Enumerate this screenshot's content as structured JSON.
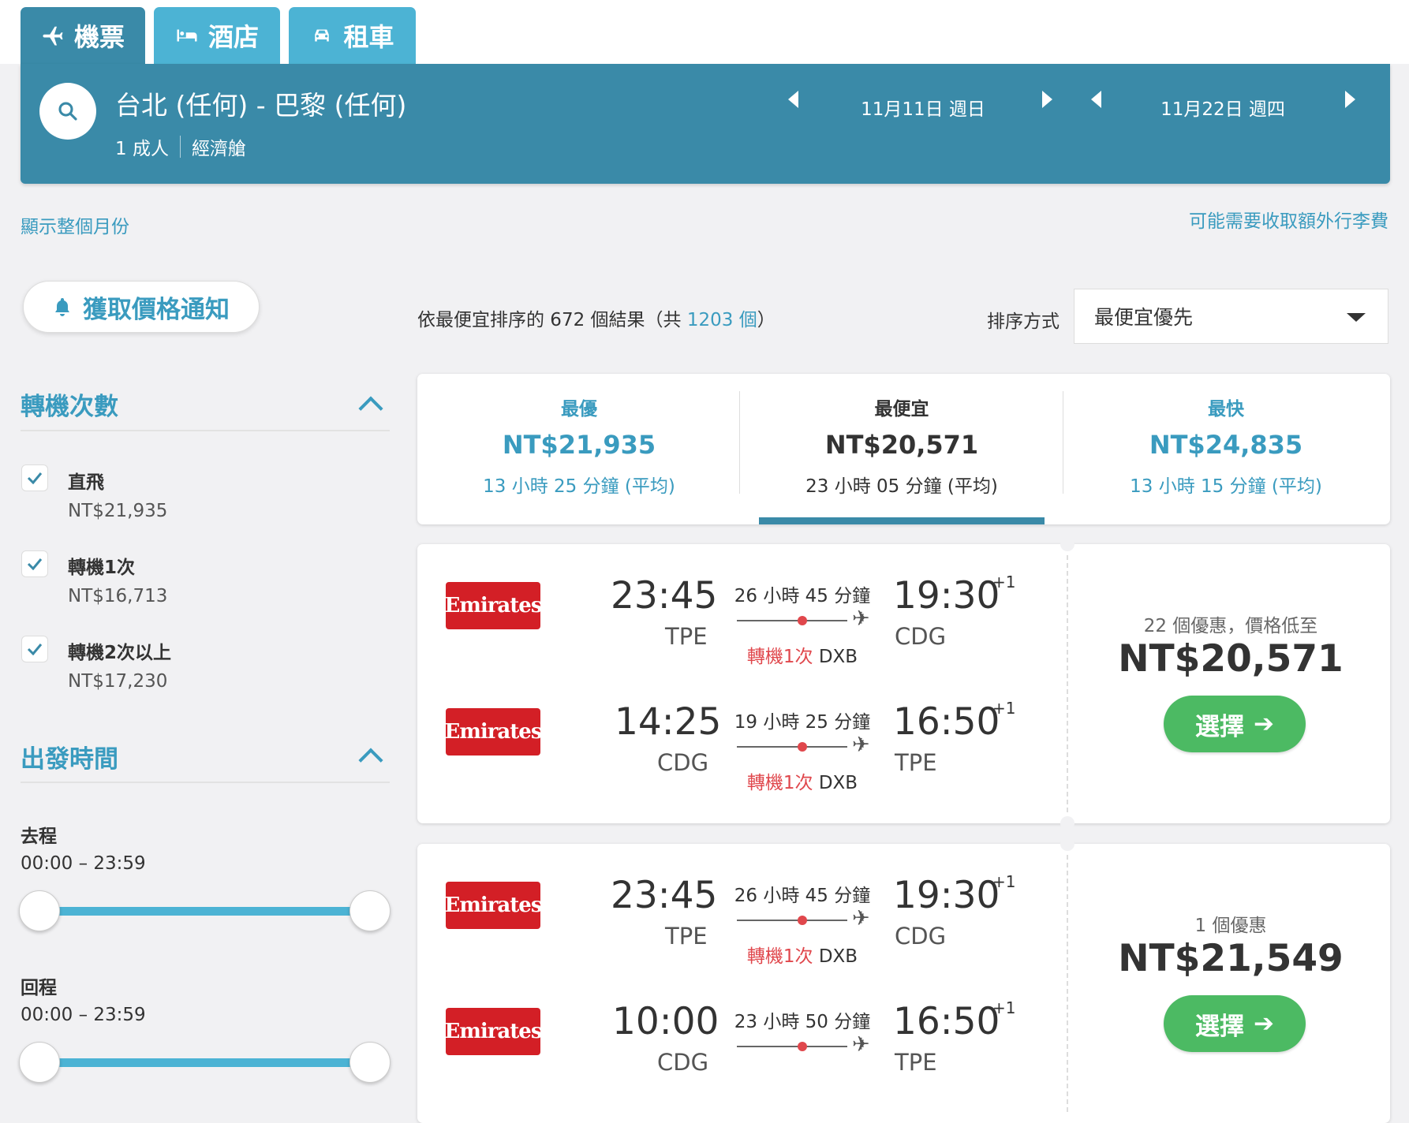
{
  "tabs": [
    {
      "label": "機票",
      "icon": "plane-icon"
    },
    {
      "label": "酒店",
      "icon": "bed-icon"
    },
    {
      "label": "租車",
      "icon": "car-icon"
    }
  ],
  "search": {
    "route": "台北 (任何) - 巴黎 (任何)",
    "passengers": "1 成人",
    "cabin": "經濟艙",
    "depart_date": "11月11日 週日",
    "return_date": "11月22日 週四"
  },
  "links": {
    "show_month": "顯示整個月份",
    "baggage_fee": "可能需要收取額外行李費"
  },
  "price_alert": "獲取價格通知",
  "filters": {
    "stops_title": "轉機次數",
    "stops": [
      {
        "label": "直飛",
        "price": "NT$21,935",
        "checked": true
      },
      {
        "label": "轉機1次",
        "price": "NT$16,713",
        "checked": true
      },
      {
        "label": "轉機2次以上",
        "price": "NT$17,230",
        "checked": true
      }
    ],
    "times_title": "出發時間",
    "outbound_label": "去程",
    "outbound_range": "00:00 – 23:59",
    "return_label": "回程",
    "return_range": "00:00 – 23:59"
  },
  "results": {
    "prefix": "依最便宜排序的 672 個結果（共 ",
    "total": "1203 個",
    "suffix": "）",
    "sort_label": "排序方式",
    "sort_value": "最便宜優先"
  },
  "summary": [
    {
      "title": "最優",
      "price": "NT$21,935",
      "duration": "13 小時 25 分鐘 (平均)"
    },
    {
      "title": "最便宜",
      "price": "NT$20,571",
      "duration": "23 小時 05 分鐘 (平均)"
    },
    {
      "title": "最快",
      "price": "NT$24,835",
      "duration": "13 小時 15 分鐘 (平均)"
    }
  ],
  "flights": [
    {
      "legs": [
        {
          "airline": "Emirates",
          "dep_time": "23:45",
          "dep_code": "TPE",
          "duration": "26 小時 45 分鐘",
          "stops": "轉機1次",
          "via": "DXB",
          "arr_time": "19:30",
          "arr_code": "CDG",
          "day_offset": "+1"
        },
        {
          "airline": "Emirates",
          "dep_time": "14:25",
          "dep_code": "CDG",
          "duration": "19 小時 25 分鐘",
          "stops": "轉機1次",
          "via": "DXB",
          "arr_time": "16:50",
          "arr_code": "TPE",
          "day_offset": "+1"
        }
      ],
      "deals": "22 個優惠，價格低至",
      "price": "NT$20,571",
      "button": "選擇"
    },
    {
      "legs": [
        {
          "airline": "Emirates",
          "dep_time": "23:45",
          "dep_code": "TPE",
          "duration": "26 小時 45 分鐘",
          "stops": "轉機1次",
          "via": "DXB",
          "arr_time": "19:30",
          "arr_code": "CDG",
          "day_offset": "+1"
        },
        {
          "airline": "Emirates",
          "dep_time": "10:00",
          "dep_code": "CDG",
          "duration": "23 小時 50 分鐘",
          "arr_time": "16:50",
          "arr_code": "TPE",
          "day_offset": "+1"
        }
      ],
      "deals": "1 個優惠",
      "price": "NT$21,549",
      "button": "選擇"
    }
  ]
}
